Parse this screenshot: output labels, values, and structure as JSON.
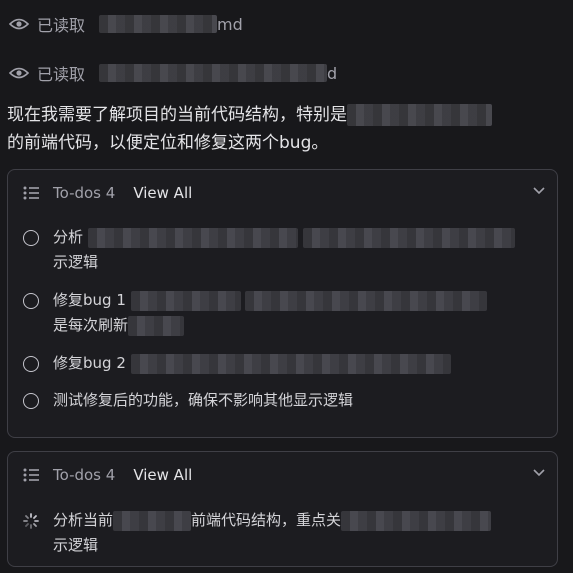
{
  "read_events": [
    {
      "label": "已读取",
      "file_suffix": "md",
      "icon": "eye-icon"
    },
    {
      "label": "已读取",
      "file_suffix": "d",
      "icon": "eye-icon"
    }
  ],
  "message": {
    "line1_prefix": "现在我需要了解项目的当前代码结构，特别是",
    "line2": "的前端代码，以便定位和修复这两个bug。"
  },
  "todo_cards": [
    {
      "title": "To-dos 4",
      "view_all": "View All",
      "items": [
        {
          "status": "pending",
          "prefix": "分析",
          "tail": "示逻辑"
        },
        {
          "status": "pending",
          "prefix": "修复bug 1",
          "tail": "是每次刷新"
        },
        {
          "status": "pending",
          "prefix": "修复bug 2",
          "tail": ""
        },
        {
          "status": "pending",
          "prefix": "测试修复后的功能，确保不影响其他显示逻辑",
          "tail": ""
        }
      ]
    },
    {
      "title": "To-dos 4",
      "view_all": "View All",
      "items": [
        {
          "status": "in-progress",
          "prefix": "分析当前",
          "middle": "前端代码结构，重点关",
          "tail": "示逻辑"
        }
      ]
    }
  ],
  "colors": {
    "background": "#18181b",
    "card_border": "#3f3f46",
    "text": "#d4d4d8",
    "muted": "#a1a1aa"
  }
}
